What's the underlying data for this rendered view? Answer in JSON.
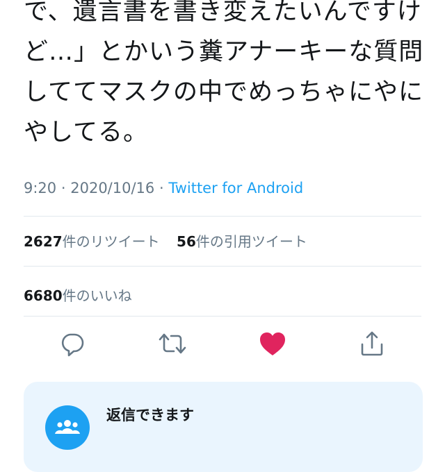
{
  "tweet": {
    "lines": [
      "で、遺言書を書き変えたいんですけ",
      "ど…」とかいう糞アナーキーな質問",
      "しててマスクの中でめっちゃにやに",
      "やしてる。"
    ],
    "time": "9:20",
    "separator": "·",
    "date": "2020/10/16",
    "source": "Twitter for Android"
  },
  "stats": {
    "retweets_count": "2627",
    "retweets_label": "件のリツイート",
    "quotes_count": "56",
    "quotes_label": "件の引用ツイート",
    "likes_count": "6680",
    "likes_label": "件のいいね"
  },
  "actions": [
    {
      "name": "reply",
      "icon": "reply-icon"
    },
    {
      "name": "retweet",
      "icon": "retweet-icon"
    },
    {
      "name": "like",
      "icon": "heart-icon",
      "active": true
    },
    {
      "name": "share",
      "icon": "share-icon"
    }
  ],
  "reply_restriction": {
    "title": "返信できます",
    "icon": "people-icon"
  },
  "colors": {
    "accent": "#1da1f2",
    "like_active": "#e0245e",
    "highlight": "#fff59a",
    "card_bg": "#eaf5fe"
  }
}
